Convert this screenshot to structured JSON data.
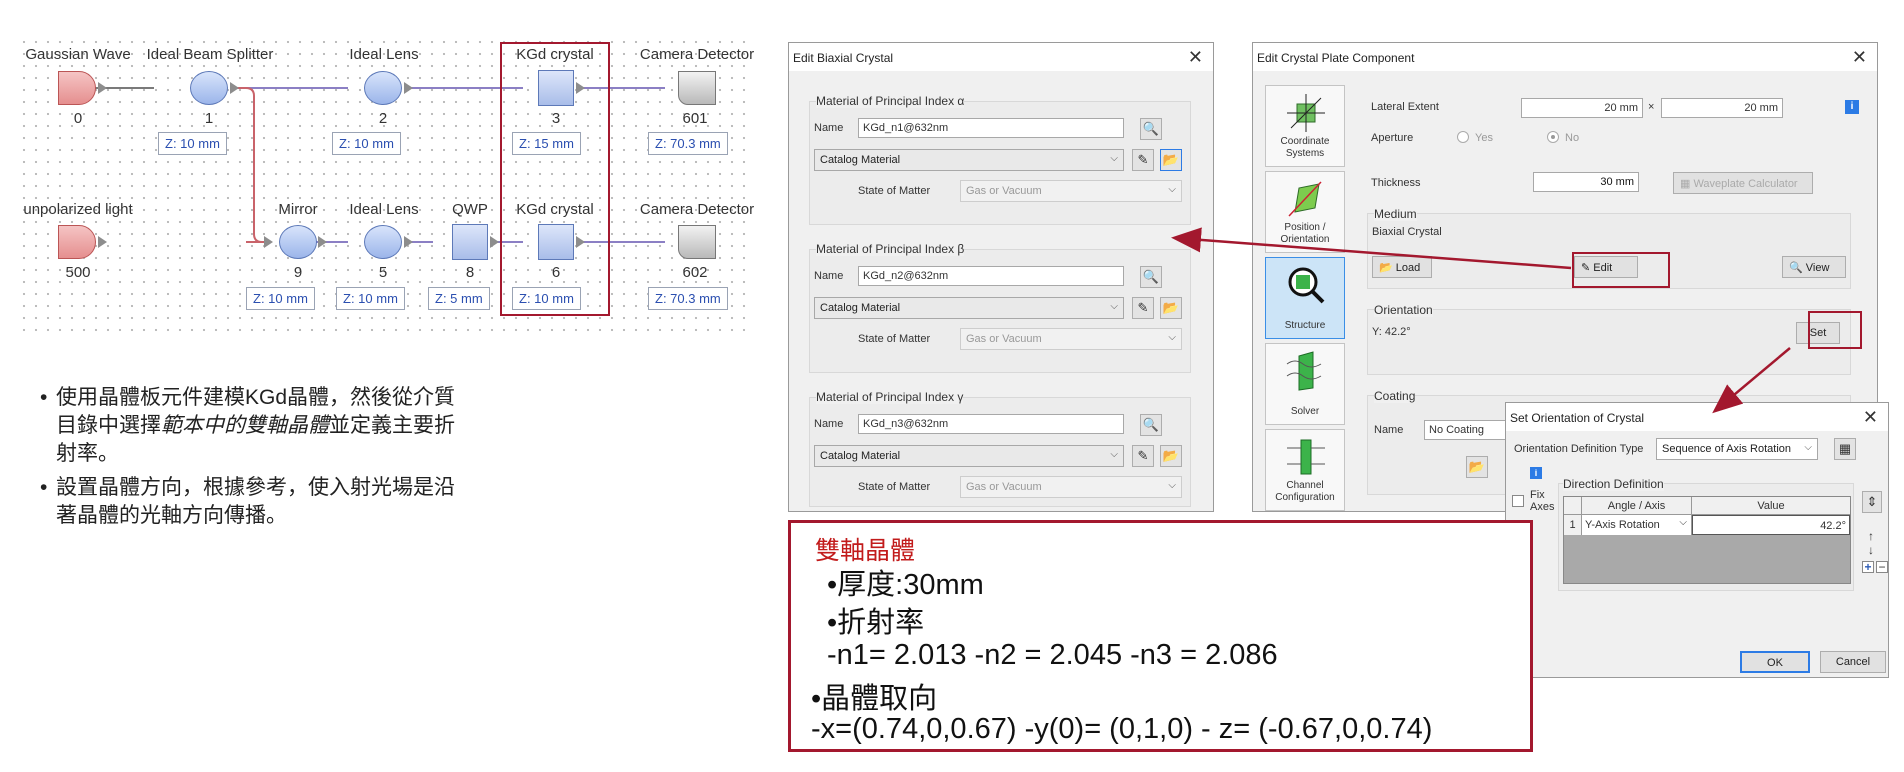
{
  "system": {
    "components": [
      {
        "id": "gaussian-wave",
        "label": "Gaussian Wave",
        "index": "0"
      },
      {
        "id": "ideal-beam-splitter",
        "label": "Ideal Beam Splitter",
        "index": "1",
        "z": "Z: 10 mm"
      },
      {
        "id": "ideal-lens-top",
        "label": "Ideal Lens",
        "index": "2",
        "z": "Z: 10 mm"
      },
      {
        "id": "kgd-crystal-top",
        "label": "KGd crystal",
        "index": "3",
        "z": "Z: 15 mm"
      },
      {
        "id": "camera-detector-top",
        "label": "Camera Detector",
        "index": "601",
        "z": "Z: 70.3 mm"
      },
      {
        "id": "unpolarized-light",
        "label": "unpolarized light",
        "index": "500"
      },
      {
        "id": "mirror",
        "label": "Mirror",
        "index": "9",
        "z": "Z: 10 mm"
      },
      {
        "id": "ideal-lens-bottom",
        "label": "Ideal Lens",
        "index": "5",
        "z": "Z: 10 mm"
      },
      {
        "id": "qwp",
        "label": "QWP",
        "index": "8",
        "z": "Z: 5 mm"
      },
      {
        "id": "kgd-crystal-bottom",
        "label": "KGd crystal",
        "index": "6",
        "z": "Z: 10 mm"
      },
      {
        "id": "camera-detector-bottom",
        "label": "Camera Detector",
        "index": "602",
        "z": "Z: 70.3 mm"
      }
    ]
  },
  "notes": [
    {
      "text": "使用晶體板元件建模KGd晶體，然後從介質目錄中選擇",
      "em": "範本中的雙軸晶體",
      "tail": "並定義主要折射率。"
    },
    {
      "text": "設置晶體方向，根據參考，使入射光場是沿著晶體的光軸方向傳播。",
      "em": "",
      "tail": ""
    }
  ],
  "biaxial": {
    "title": "Edit Biaxial Crystal",
    "groups": [
      {
        "title": "Material of Principal Index α",
        "name_label": "Name",
        "name": "KGd_n1@632nm",
        "catalog": "Catalog Material",
        "state_label": "State of Matter",
        "state": "Gas or Vacuum"
      },
      {
        "title": "Material of Principal Index β",
        "name_label": "Name",
        "name": "KGd_n2@632nm",
        "catalog": "Catalog Material",
        "state_label": "State of Matter",
        "state": "Gas or Vacuum"
      },
      {
        "title": "Material of Principal Index γ",
        "name_label": "Name",
        "name": "KGd_n3@632nm",
        "catalog": "Catalog Material",
        "state_label": "State of Matter",
        "state": "Gas or Vacuum"
      }
    ]
  },
  "plate": {
    "title": "Edit Crystal Plate Component",
    "sidebar": [
      {
        "id": "coordinate-systems",
        "label": "Coordinate Systems"
      },
      {
        "id": "position-orientation",
        "label": "Position / Orientation"
      },
      {
        "id": "structure",
        "label": "Structure"
      },
      {
        "id": "solver",
        "label": "Solver"
      },
      {
        "id": "channel-configuration",
        "label": "Channel Configuration"
      }
    ],
    "lateral_label": "Lateral Extent",
    "lateral_x": "20 mm",
    "times": "×",
    "lateral_y": "20 mm",
    "aperture_label": "Aperture",
    "yes": "Yes",
    "no": "No",
    "thickness_label": "Thickness",
    "thickness": "30 mm",
    "waveplate": "Waveplate Calculator",
    "medium_title": "Medium",
    "medium": "Biaxial Crystal",
    "load": "Load",
    "edit": "Edit",
    "view": "View",
    "orientation_title": "Orientation",
    "orientation": "Y: 42.2°",
    "set": "Set",
    "coating_title": "Coating",
    "coating_name_label": "Name",
    "coating": "No Coating"
  },
  "orient": {
    "title": "Set Orientation of Crystal",
    "type_label": "Orientation Definition Type",
    "type": "Sequence of Axis Rotation",
    "dir_title": "Direction Definition",
    "fix_axes": "Fix Axes",
    "col_axis": "Angle / Axis",
    "col_value": "Value",
    "row_index": "1",
    "row_axis": "Y-Axis Rotation",
    "row_value": "42.2°",
    "ok": "OK",
    "cancel": "Cancel"
  },
  "summary": {
    "heading": "雙軸晶體",
    "thickness": "•厚度:30mm",
    "refr": "•折射率",
    "n_values": "-n1= 2.013 -n2 = 2.045    -n3 = 2.086",
    "orient": "•晶體取向",
    "axes": "-x=(0.74,0,0.67) -y(0)= (0,1,0) -      z= (-0.67,0,0.74)"
  },
  "colors": {
    "accent_red": "#a3182e",
    "heading_red": "#c21b1b",
    "z_blue": "#2b4fb0",
    "selected": "#cce4f7"
  }
}
